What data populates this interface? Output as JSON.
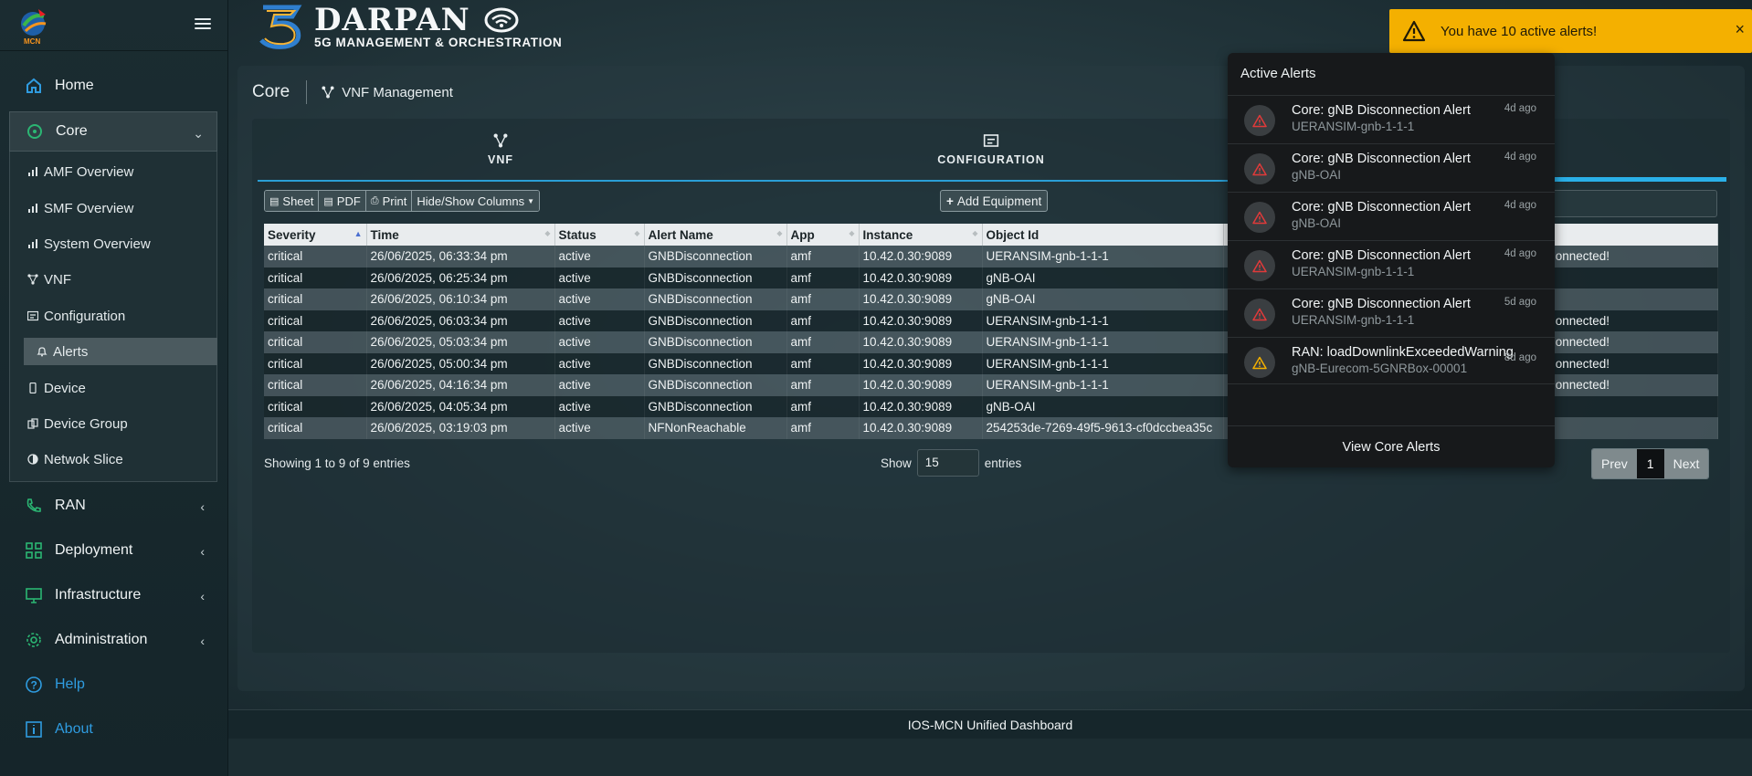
{
  "sidebar": {
    "logo_text": "MCN",
    "items": [
      {
        "label": "Home",
        "icon": "home-icon"
      },
      {
        "label": "Core",
        "icon": "core-icon"
      },
      {
        "label": "RAN",
        "icon": "phone-icon"
      },
      {
        "label": "Deployment",
        "icon": "grid-icon"
      },
      {
        "label": "Infrastructure",
        "icon": "monitor-icon"
      },
      {
        "label": "Administration",
        "icon": "gear-icon"
      },
      {
        "label": "Help",
        "icon": "help-icon"
      },
      {
        "label": "About",
        "icon": "info-icon"
      }
    ],
    "core_sub": [
      {
        "label": "AMF Overview",
        "icon": "bar-chart-icon"
      },
      {
        "label": "SMF Overview",
        "icon": "bar-chart-icon"
      },
      {
        "label": "System Overview",
        "icon": "bar-chart-icon"
      },
      {
        "label": "VNF",
        "icon": "network-icon"
      },
      {
        "label": "Configuration",
        "icon": "config-icon"
      },
      {
        "label": "Alerts",
        "icon": "bell-icon"
      },
      {
        "label": "Device",
        "icon": "device-icon"
      },
      {
        "label": "Device Group",
        "icon": "device-group-icon"
      },
      {
        "label": "Netwok Slice",
        "icon": "slice-icon"
      }
    ]
  },
  "header": {
    "brand_title": "DARPAN",
    "brand_subtitle": "5G MANAGEMENT & ORCHESTRATION"
  },
  "breadcrumb": {
    "section": "Core",
    "page": "VNF Management"
  },
  "tabs": [
    {
      "label": "VNF",
      "icon": "network-icon"
    },
    {
      "label": "CONFIGURATION",
      "icon": "config-icon"
    }
  ],
  "toolbar": {
    "sheet": "Sheet",
    "pdf": "PDF",
    "print": "Print",
    "columns": "Hide/Show Columns",
    "add": "Add Equipment"
  },
  "table": {
    "headers": [
      "Severity",
      "Time",
      "Status",
      "Alert Name",
      "App",
      "Instance",
      "Object Id",
      ""
    ],
    "rows": [
      [
        "critical",
        "26/06/2025, 06:33:34 pm",
        "active",
        "GNBDisconnection",
        "amf",
        "10.42.0.30:9089",
        "UERANSIM-gnb-1-1-1",
        "onnected!"
      ],
      [
        "critical",
        "26/06/2025, 06:25:34 pm",
        "active",
        "GNBDisconnection",
        "amf",
        "10.42.0.30:9089",
        "gNB-OAI",
        ""
      ],
      [
        "critical",
        "26/06/2025, 06:10:34 pm",
        "active",
        "GNBDisconnection",
        "amf",
        "10.42.0.30:9089",
        "gNB-OAI",
        ""
      ],
      [
        "critical",
        "26/06/2025, 06:03:34 pm",
        "active",
        "GNBDisconnection",
        "amf",
        "10.42.0.30:9089",
        "UERANSIM-gnb-1-1-1",
        "onnected!"
      ],
      [
        "critical",
        "26/06/2025, 05:03:34 pm",
        "active",
        "GNBDisconnection",
        "amf",
        "10.42.0.30:9089",
        "UERANSIM-gnb-1-1-1",
        "onnected!"
      ],
      [
        "critical",
        "26/06/2025, 05:00:34 pm",
        "active",
        "GNBDisconnection",
        "amf",
        "10.42.0.30:9089",
        "UERANSIM-gnb-1-1-1",
        "onnected!"
      ],
      [
        "critical",
        "26/06/2025, 04:16:34 pm",
        "active",
        "GNBDisconnection",
        "amf",
        "10.42.0.30:9089",
        "UERANSIM-gnb-1-1-1",
        "onnected!"
      ],
      [
        "critical",
        "26/06/2025, 04:05:34 pm",
        "active",
        "GNBDisconnection",
        "amf",
        "10.42.0.30:9089",
        "gNB-OAI",
        ""
      ],
      [
        "critical",
        "26/06/2025, 03:19:03 pm",
        "active",
        "NFNonReachable",
        "amf",
        "10.42.0.30:9089",
        "254253de-7269-49f5-9613-cf0dccbea35c",
        ""
      ]
    ]
  },
  "footer_info": {
    "showing": "Showing 1 to 9 of 9 entries",
    "show": "Show",
    "entries": "entries",
    "page_size": "15"
  },
  "pager": {
    "prev": "Prev",
    "current": "1",
    "next": "Next"
  },
  "footer": {
    "text": "IOS-MCN Unified Dashboard"
  },
  "toast": {
    "text": "You have 10 active alerts!",
    "close": "×"
  },
  "alerts_dropdown": {
    "title": "Active Alerts",
    "items": [
      {
        "title": "Core: gNB Disconnection Alert",
        "sub": "UERANSIM-gnb-1-1-1",
        "time": "4d ago",
        "level": "critical"
      },
      {
        "title": "Core: gNB Disconnection Alert",
        "sub": "gNB-OAI",
        "time": "4d ago",
        "level": "critical"
      },
      {
        "title": "Core: gNB Disconnection Alert",
        "sub": "gNB-OAI",
        "time": "4d ago",
        "level": "critical"
      },
      {
        "title": "Core: gNB Disconnection Alert",
        "sub": "UERANSIM-gnb-1-1-1",
        "time": "4d ago",
        "level": "critical"
      },
      {
        "title": "Core: gNB Disconnection Alert",
        "sub": "UERANSIM-gnb-1-1-1",
        "time": "5d ago",
        "level": "critical"
      },
      {
        "title": "RAN: loadDownlinkExceededWarning",
        "sub": "gNB-Eurecom-5GNRBox-00001",
        "time": "8d ago",
        "level": "warning"
      }
    ],
    "view_all": "View Core Alerts"
  },
  "colors": {
    "accent": "#2a9fd6",
    "toast": "#f4b000",
    "critical": "#e03a3a",
    "warning": "#f4b000",
    "nav_icon": "#2f9ce0",
    "nav_icon_green": "#2bb673"
  }
}
